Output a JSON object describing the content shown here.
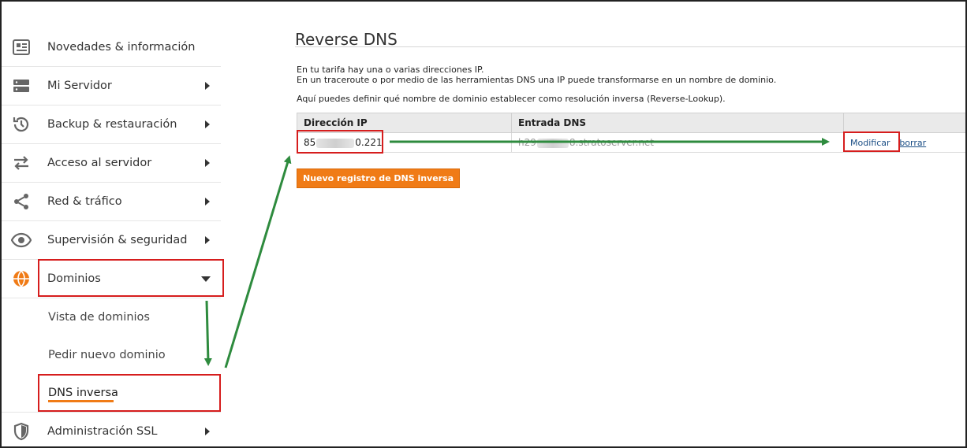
{
  "sidebar": {
    "items": [
      {
        "label": "Novedades & información",
        "icon": "newspaper-icon"
      },
      {
        "label": "Mi Servidor",
        "icon": "server-icon"
      },
      {
        "label": "Backup & restauración",
        "icon": "history-icon"
      },
      {
        "label": "Acceso al servidor",
        "icon": "transfer-arrows-icon"
      },
      {
        "label": "Red & tráfico",
        "icon": "share-network-icon"
      },
      {
        "label": "Supervisión & seguridad",
        "icon": "eye-icon"
      },
      {
        "label": "Dominios",
        "icon": "globe-icon"
      }
    ],
    "subitems": [
      {
        "label": "Vista de dominios"
      },
      {
        "label": "Pedir nuevo dominio"
      },
      {
        "label": "DNS inversa"
      }
    ],
    "after": {
      "label": "Administración SSL",
      "icon": "shield-icon"
    }
  },
  "main": {
    "title": "Reverse DNS",
    "desc1": "En tu tarifa hay una o varias direcciones IP.",
    "desc2": "En un traceroute o por medio de las herramientas DNS una IP puede transformarse en un nombre de dominio.",
    "desc3": "Aquí puedes definir qué nombre de dominio establecer como resolución inversa (Reverse-Lookup).",
    "table": {
      "headers": [
        "Dirección IP",
        "Entrada DNS",
        ""
      ],
      "row": {
        "ip_start": "85",
        "ip_end": "0.221",
        "dns_start": "h29",
        "dns_end": "8.stratoserver.net",
        "modify": "Modificar",
        "delete": "borrar"
      }
    },
    "new_button": "Nuevo registro de DNS inversa"
  },
  "colors": {
    "accent": "#f07b16",
    "highlight": "#d61d1d",
    "arrow": "#2e8b3e"
  }
}
